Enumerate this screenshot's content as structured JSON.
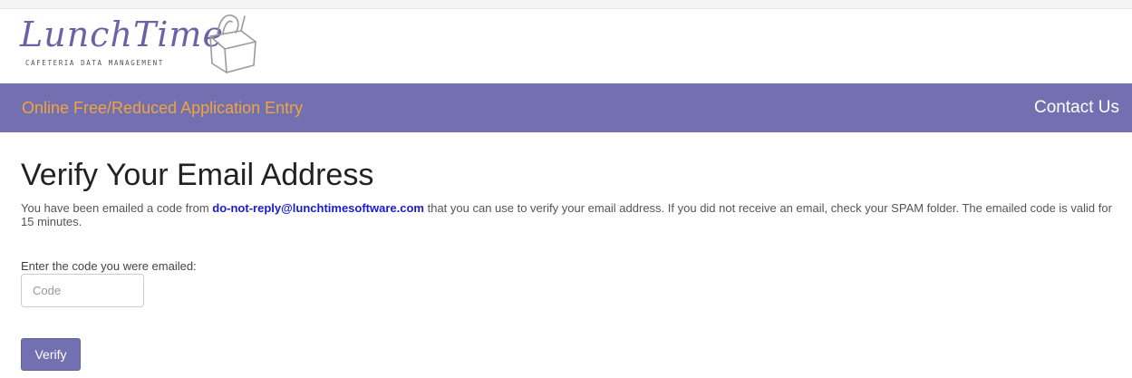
{
  "logo": {
    "name": "LunchTime",
    "tagline": "CAFETERIA DATA MANAGEMENT",
    "icon": "lunchbox-icon"
  },
  "navbar": {
    "title": "Online Free/Reduced Application Entry",
    "contact_label": "Contact Us"
  },
  "main": {
    "heading": "Verify Your Email Address",
    "message_prefix": "You have been emailed a code from ",
    "sender_email": "do-not-reply@lunchtimesoftware.com",
    "message_suffix": " that you can use to verify your email address. If you did not receive an email, check your SPAM folder. The emailed code is valid for 15 minutes.",
    "code_label": "Enter the code you were emailed:",
    "code_value": "",
    "code_placeholder": "Code",
    "verify_label": "Verify"
  },
  "colors": {
    "nav_background": "#7370b2",
    "nav_title": "#f0a43a",
    "link": "#1a1ad6",
    "logo": "#6a63a8"
  }
}
